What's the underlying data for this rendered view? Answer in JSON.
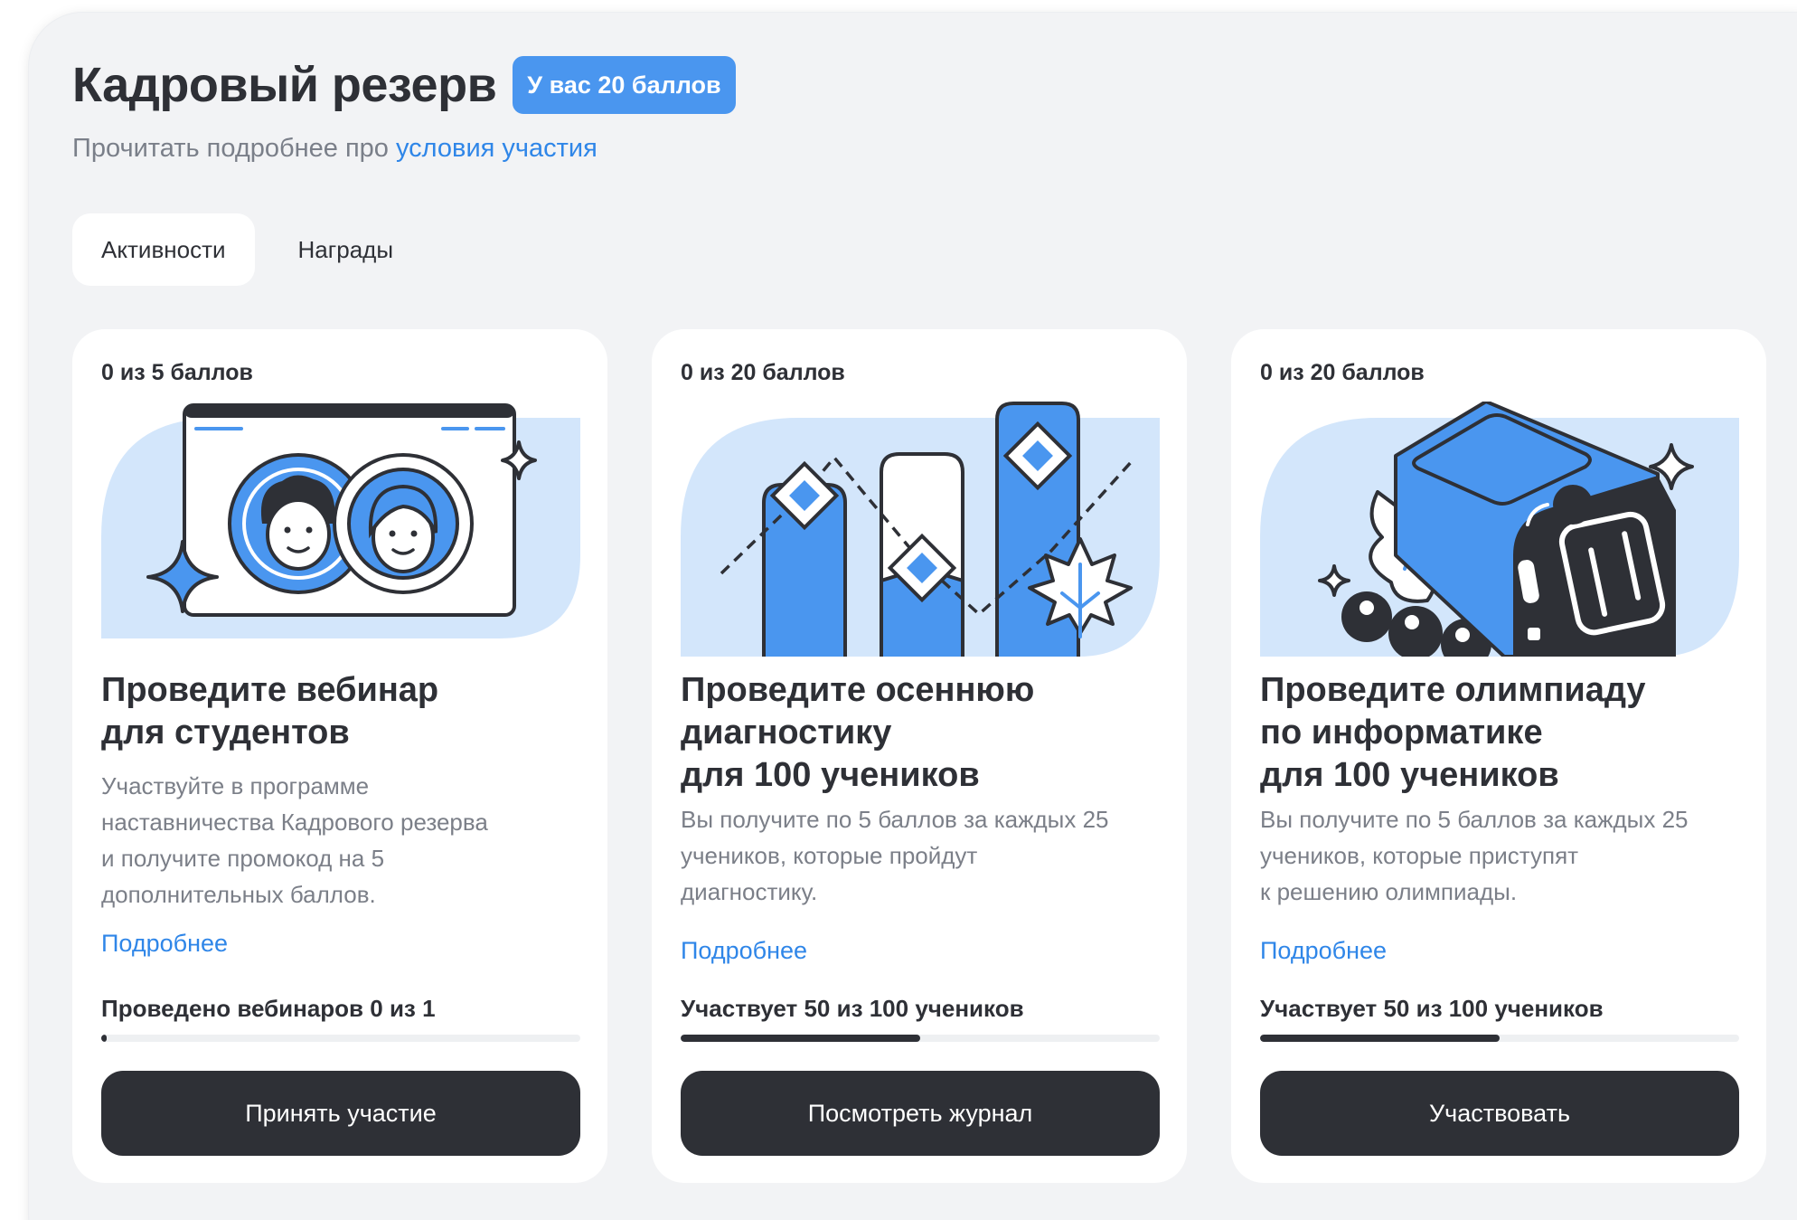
{
  "header": {
    "title": "Кадровый резерв",
    "badge": "У вас 20 баллов",
    "subtitle_prefix": "Прочитать подробнее про ",
    "subtitle_link": "условия участия"
  },
  "tabs": [
    {
      "label": "Активности",
      "active": true
    },
    {
      "label": "Награды",
      "active": false
    }
  ],
  "colors": {
    "accent": "#4a96ef",
    "link": "#2f86e8",
    "dark": "#2e3036",
    "background": "#f2f3f5"
  },
  "cards": [
    {
      "score": "0 из 5 баллов",
      "illustration": "webinar-illustration",
      "title": "Проведите вебинар\nдля студентов",
      "description": "Участвуйте в программе\nнаставничества Кадрового резерва\nи получите промокод на 5\nдополнительных баллов.",
      "more": "Подробнее",
      "progress_label": "Проведено вебинаров 0 из 1",
      "progress": 0,
      "button": "Принять участие"
    },
    {
      "score": "0 из 20 баллов",
      "illustration": "diagnostics-chart-illustration",
      "title": "Проведите осеннюю\nдиагностику\nдля 100 учеников",
      "description": "Вы получите по 5 баллов за каждых 25\nучеников, которые пройдут\nдиагностику.",
      "more": "Подробнее",
      "progress_label": "Участвует 50 из 100 учеников",
      "progress": 0.5,
      "button": "Посмотреть журнал"
    },
    {
      "score": "0 из 20 баллов",
      "illustration": "rocket-laptop-illustration",
      "title": "Проведите олимпиаду\nпо информатике\nдля 100 учеников",
      "description": "Вы получите по 5 баллов за каждых 25\nучеников, которые приступят\nк решению олимпиады.",
      "more": "Подробнее",
      "progress_label": "Участвует 50 из 100 учеников",
      "progress": 0.5,
      "button": "Участвовать"
    }
  ]
}
